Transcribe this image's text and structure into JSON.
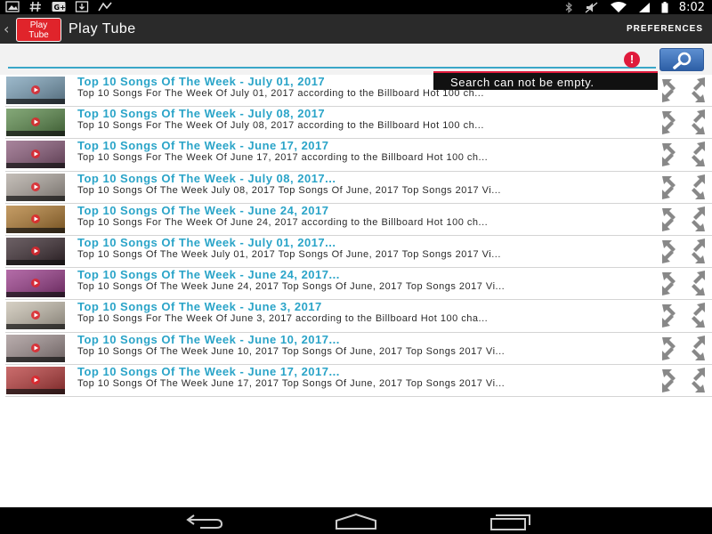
{
  "status_bar": {
    "time": "8:02",
    "left_icons": [
      "image-icon",
      "hashtag-icon",
      "google-plus-icon",
      "download-icon",
      "alert-icon"
    ],
    "right_icons": [
      "bluetooth-icon",
      "mute-icon",
      "wifi-icon",
      "signal-icon",
      "battery-icon"
    ]
  },
  "action_bar": {
    "back_icon": "chevron-left-icon",
    "logo_line1": "Play",
    "logo_line2": "Tube",
    "title": "Play Tube",
    "preferences_label": "PREFERENCES"
  },
  "search": {
    "value": "",
    "placeholder": "",
    "error_message": "Search can not be empty.",
    "button_icon": "search-icon"
  },
  "videos": [
    {
      "title": "Top 10 Songs Of The Week - July 01, 2017",
      "description": "Top 10 Songs For The Week Of July 01, 2017 according to the Billboard Hot 100 ch...",
      "thumb": "#7aa0b8"
    },
    {
      "title": "Top 10 Songs Of The Week - July 08, 2017",
      "description": "Top 10 Songs For The Week Of July 08, 2017 according to the Billboard Hot 100 ch...",
      "thumb": "#5a8a4a"
    },
    {
      "title": "Top 10 Songs Of The Week - June 17, 2017",
      "description": "Top 10 Songs For The Week Of June 17, 2017 according to the Billboard Hot 100 ch...",
      "thumb": "#8a5a7a"
    },
    {
      "title": "Top 10 Songs Of The Week - July 08, 2017...",
      "description": "Top 10 Songs Of The Week July 08, 2017 Top Songs Of June, 2017 Top Songs 2017 Vi...",
      "thumb": "#b0a8a0"
    },
    {
      "title": "Top 10 Songs Of The Week - June 24, 2017",
      "description": "Top 10 Songs For The Week Of June 24, 2017 according to the Billboard Hot 100 ch...",
      "thumb": "#b07a30"
    },
    {
      "title": "Top 10 Songs Of The Week - July 01, 2017...",
      "description": "Top 10 Songs Of The Week July 01, 2017 Top Songs Of June, 2017 Top Songs 2017 Vi...",
      "thumb": "#3a2a30"
    },
    {
      "title": "Top 10 Songs Of The Week - June 24, 2017...",
      "description": "Top 10 Songs Of The Week June 24, 2017 Top Songs Of June, 2017 Top Songs 2017 Vi...",
      "thumb": "#9a3a8a"
    },
    {
      "title": "Top 10 Songs Of The Week - June 3, 2017",
      "description": "Top 10 Songs For The Week Of June 3, 2017 according to the Billboard Hot 100 cha...",
      "thumb": "#c8c0b0"
    },
    {
      "title": "Top 10 Songs Of The Week - June 10, 2017...",
      "description": "Top 10 Songs Of The Week June 10, 2017 Top Songs Of June, 2017 Top Songs 2017 Vi...",
      "thumb": "#a09090"
    },
    {
      "title": "Top 10 Songs Of The Week - June 17, 2017...",
      "description": "Top 10 Songs Of The Week June 17, 2017 Top Songs Of June, 2017 Top Songs 2017 Vi...",
      "thumb": "#b83a3a"
    }
  ],
  "row_action_icon": "expand-icon",
  "nav_bar": {
    "icons": [
      "back-icon",
      "home-icon",
      "recents-icon"
    ]
  },
  "colors": {
    "title_accent": "#2aa4c8",
    "brand_red": "#e0242b",
    "error_red": "#e01a3c",
    "search_button": "#3d6fb8"
  }
}
